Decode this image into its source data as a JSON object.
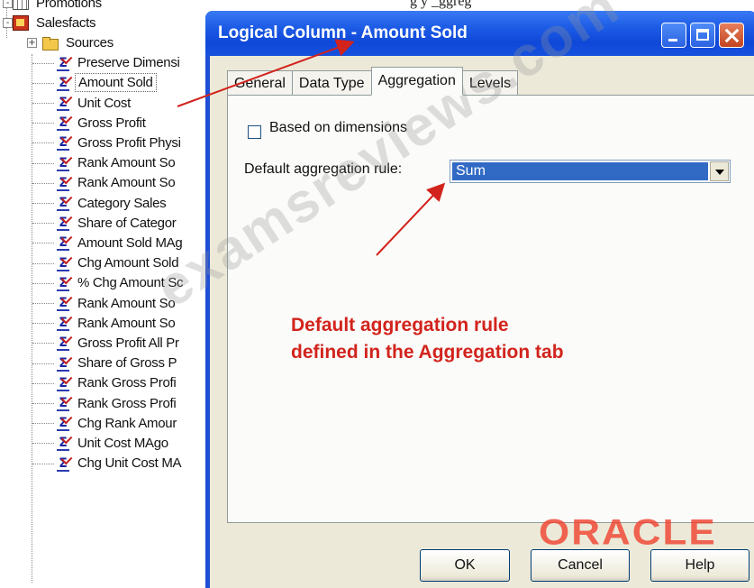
{
  "top_caption": "g          y         _ggreg",
  "tree": {
    "items": [
      {
        "label": "Promotions",
        "icon": "table-icon",
        "level": 0
      },
      {
        "label": "Salesfacts",
        "icon": "fact-table-icon",
        "level": 0
      },
      {
        "label": "Sources",
        "icon": "folder-icon",
        "level": 1
      },
      {
        "label": "Preserve Dimensi",
        "icon": "logical-column-icon",
        "level": 2
      },
      {
        "label": "Amount Sold",
        "icon": "logical-column-icon",
        "level": 2,
        "selected": true
      },
      {
        "label": "Unit Cost",
        "icon": "logical-column-icon",
        "level": 2
      },
      {
        "label": "Gross Profit",
        "icon": "logical-column-icon",
        "level": 2
      },
      {
        "label": "Gross Profit Physi",
        "icon": "logical-column-icon",
        "level": 2
      },
      {
        "label": "Rank Amount So",
        "icon": "logical-column-icon",
        "level": 2
      },
      {
        "label": "Rank Amount So",
        "icon": "logical-column-icon",
        "level": 2
      },
      {
        "label": "Category Sales",
        "icon": "logical-column-icon",
        "level": 2
      },
      {
        "label": "Share of Categor",
        "icon": "logical-column-icon",
        "level": 2
      },
      {
        "label": "Amount Sold MAg",
        "icon": "logical-column-icon",
        "level": 2
      },
      {
        "label": "Chg Amount Sold",
        "icon": "logical-column-icon",
        "level": 2
      },
      {
        "label": "% Chg Amount Sc",
        "icon": "logical-column-icon",
        "level": 2
      },
      {
        "label": "Rank Amount So",
        "icon": "logical-column-icon",
        "level": 2
      },
      {
        "label": "Rank Amount So",
        "icon": "logical-column-icon",
        "level": 2
      },
      {
        "label": "Gross Profit All Pr",
        "icon": "logical-column-icon",
        "level": 2
      },
      {
        "label": "Share of Gross P",
        "icon": "logical-column-icon",
        "level": 2
      },
      {
        "label": "Rank Gross Profi",
        "icon": "logical-column-icon",
        "level": 2
      },
      {
        "label": "Rank Gross Profi",
        "icon": "logical-column-icon",
        "level": 2
      },
      {
        "label": "Chg Rank Amour",
        "icon": "logical-column-icon",
        "level": 2
      },
      {
        "label": "Unit Cost MAgo",
        "icon": "logical-column-icon",
        "level": 2
      },
      {
        "label": "Chg Unit Cost MA",
        "icon": "logical-column-icon",
        "level": 2
      }
    ]
  },
  "dialog": {
    "title": "Logical Column - Amount Sold",
    "tabs": [
      {
        "label": "General",
        "active": false
      },
      {
        "label": "Data Type",
        "active": false
      },
      {
        "label": "Aggregation",
        "active": true
      },
      {
        "label": "Levels",
        "active": false
      }
    ],
    "based_on_dimensions_label": "Based on dimensions",
    "based_on_dimensions_checked": false,
    "default_aggregation_label": "Default aggregation rule:",
    "default_aggregation_value": "Sum",
    "buttons": {
      "ok": "OK",
      "cancel": "Cancel",
      "help": "Help"
    }
  },
  "annotation": {
    "line1": "Default aggregation rule",
    "line2": "defined in the Aggregation tab",
    "color": "#d2231c"
  },
  "brand_logo": "ORACLE",
  "watermark": "examsreviews.com",
  "colors": {
    "titlebar_blue": "#1e5de6",
    "dialog_face": "#ece9d8",
    "selection_blue": "#316ac5",
    "annotation_red": "#d2231c",
    "oracle_red": "#f0412d"
  }
}
